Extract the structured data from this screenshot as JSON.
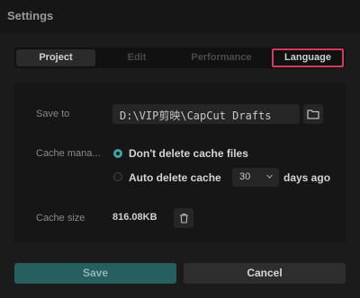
{
  "window": {
    "title": "Settings"
  },
  "tabs": [
    {
      "label": "Project",
      "active": true
    },
    {
      "label": "Edit",
      "active": false
    },
    {
      "label": "Performance",
      "active": false
    },
    {
      "label": "Language",
      "active": false,
      "highlighted": true
    }
  ],
  "save_to": {
    "label": "Save to",
    "path": "D:\\VIP剪映\\CapCut Drafts",
    "icon": "folder-icon"
  },
  "cache": {
    "label": "Cache mana...",
    "option_keep": "Don't delete cache files",
    "option_auto": "Auto delete cache",
    "days_value": "30",
    "days_suffix": "days ago",
    "selected": "keep"
  },
  "cache_size": {
    "label": "Cache size",
    "value": "816.08KB",
    "icon": "trash-icon"
  },
  "buttons": {
    "save": "Save",
    "cancel": "Cancel"
  },
  "colors": {
    "accent": "#3fa6a8",
    "save_bg": "#275f60",
    "highlight_border": "#d43a5f"
  }
}
